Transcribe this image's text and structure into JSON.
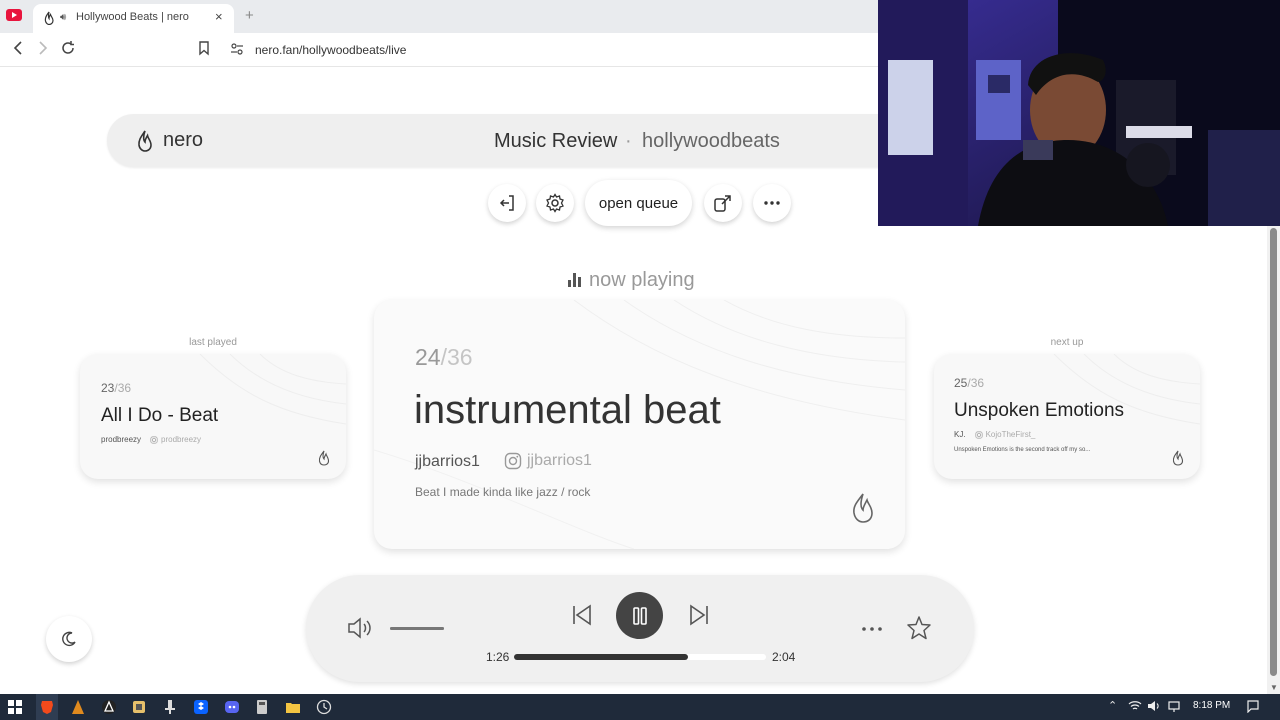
{
  "browser": {
    "tab_title": "Hollywood Beats | nero",
    "tab_close": "×",
    "new_tab": "+",
    "url": "nero.fan/hollywoodbeats/live"
  },
  "header": {
    "brand": "nero",
    "title": "Music Review",
    "separator": "·",
    "channel": "hollywoodbeats"
  },
  "toolbar": {
    "queue_label": "open queue"
  },
  "now_playing": {
    "label": "now playing"
  },
  "last_played": {
    "label": "last played",
    "index": "23",
    "total": "/36",
    "title": "All I Do - Beat",
    "artist": "prodbreezy",
    "instagram": "prodbreezy"
  },
  "current": {
    "index": "24",
    "total": "/36",
    "title": "instrumental beat",
    "artist": "jjbarrios1",
    "instagram": "jjbarrios1",
    "description": "Beat I made kinda like jazz / rock"
  },
  "next_up": {
    "label": "next up",
    "index": "25",
    "total": "/36",
    "title": "Unspoken Emotions",
    "artist": "KJ.",
    "instagram": "KojoTheFirst_",
    "description": "Unspoken Emotions is the second track off my so..."
  },
  "player": {
    "current_time": "1:26",
    "total_time": "2:04",
    "progress": 0.69,
    "volume": 1.0
  },
  "taskbar": {
    "time": "8:18 PM"
  },
  "colors": {
    "accent": "#444444",
    "youtube": "#e8143d",
    "taskbar": "#1f2a3a"
  }
}
